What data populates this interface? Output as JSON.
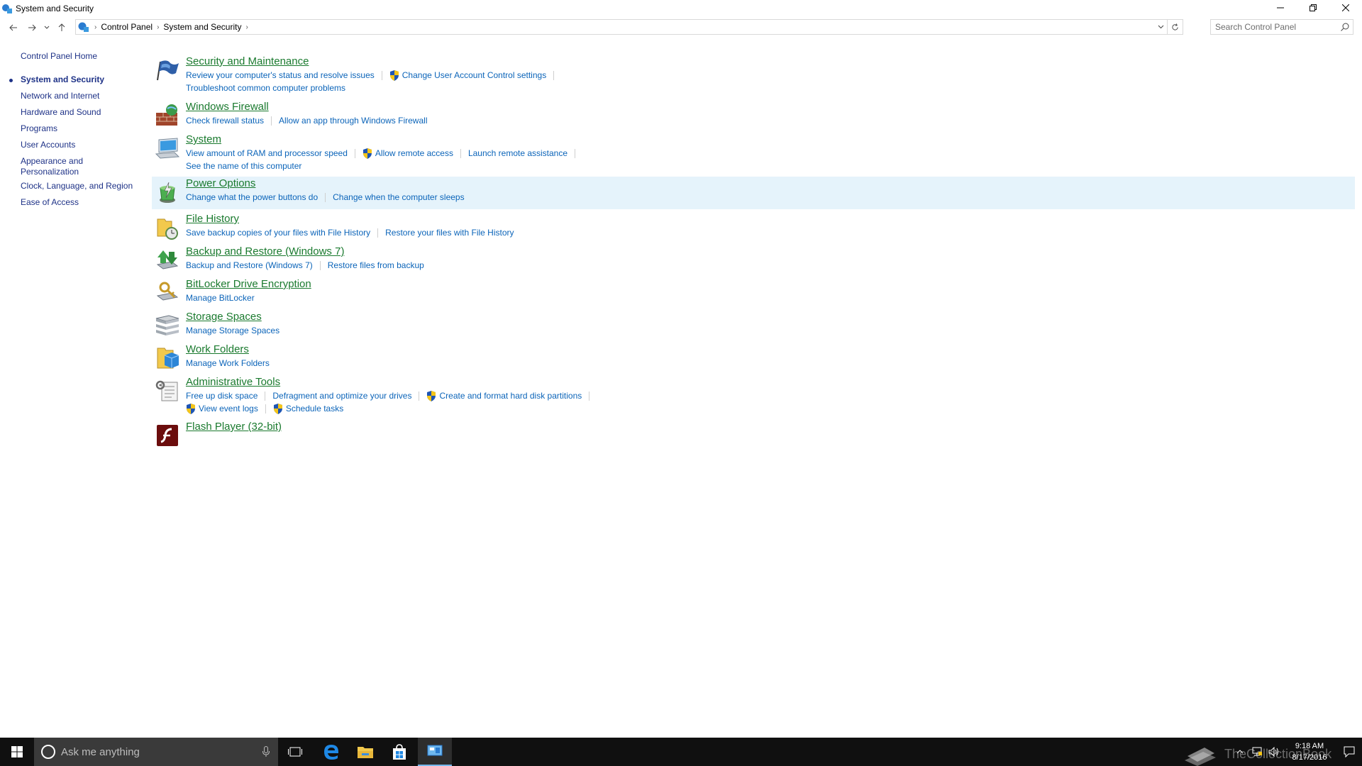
{
  "window": {
    "title": "System and Security"
  },
  "address": {
    "crumbs": [
      "Control Panel",
      "System and Security"
    ],
    "search_placeholder": "Search Control Panel"
  },
  "leftnav": {
    "items": [
      "Control Panel Home",
      "System and Security",
      "Network and Internet",
      "Hardware and Sound",
      "Programs",
      "User Accounts",
      "Appearance and Personalization",
      "Clock, Language, and Region",
      "Ease of Access"
    ],
    "current": "System and Security"
  },
  "categories": [
    {
      "title": "Security and Maintenance",
      "icon": "flag-icon",
      "lines": [
        [
          {
            "text": "Review your computer's status and resolve issues",
            "shield": false
          },
          {
            "text": "Change User Account Control settings",
            "shield": true
          }
        ],
        [
          {
            "text": "Troubleshoot common computer problems",
            "shield": false
          }
        ]
      ]
    },
    {
      "title": "Windows Firewall",
      "icon": "firewall-icon",
      "lines": [
        [
          {
            "text": "Check firewall status",
            "shield": false
          },
          {
            "text": "Allow an app through Windows Firewall",
            "shield": false
          }
        ]
      ]
    },
    {
      "title": "System",
      "icon": "computer-icon",
      "lines": [
        [
          {
            "text": "View amount of RAM and processor speed",
            "shield": false
          },
          {
            "text": "Allow remote access",
            "shield": true
          },
          {
            "text": "Launch remote assistance",
            "shield": false
          }
        ],
        [
          {
            "text": "See the name of this computer",
            "shield": false
          }
        ]
      ]
    },
    {
      "title": "Power Options",
      "icon": "power-options-icon",
      "highlighted": true,
      "lines": [
        [
          {
            "text": "Change what the power buttons do",
            "shield": false
          },
          {
            "text": "Change when the computer sleeps",
            "shield": false
          }
        ]
      ]
    },
    {
      "title": "File History",
      "icon": "file-history-icon",
      "lines": [
        [
          {
            "text": "Save backup copies of your files with File History",
            "shield": false
          },
          {
            "text": "Restore your files with File History",
            "shield": false
          }
        ]
      ]
    },
    {
      "title": "Backup and Restore (Windows 7)",
      "icon": "backup-restore-icon",
      "lines": [
        [
          {
            "text": "Backup and Restore (Windows 7)",
            "shield": false
          },
          {
            "text": "Restore files from backup",
            "shield": false
          }
        ]
      ]
    },
    {
      "title": "BitLocker Drive Encryption",
      "icon": "bitlocker-icon",
      "lines": [
        [
          {
            "text": "Manage BitLocker",
            "shield": false
          }
        ]
      ]
    },
    {
      "title": "Storage Spaces",
      "icon": "storage-spaces-icon",
      "lines": [
        [
          {
            "text": "Manage Storage Spaces",
            "shield": false
          }
        ]
      ]
    },
    {
      "title": "Work Folders",
      "icon": "work-folders-icon",
      "lines": [
        [
          {
            "text": "Manage Work Folders",
            "shield": false
          }
        ]
      ]
    },
    {
      "title": "Administrative Tools",
      "icon": "admin-tools-icon",
      "lines": [
        [
          {
            "text": "Free up disk space",
            "shield": false
          },
          {
            "text": "Defragment and optimize your drives",
            "shield": false
          },
          {
            "text": "Create and format hard disk partitions",
            "shield": true
          }
        ],
        [
          {
            "text": "View event logs",
            "shield": true
          },
          {
            "text": "Schedule tasks",
            "shield": true
          }
        ]
      ]
    },
    {
      "title": "Flash Player (32-bit)",
      "icon": "flash-player-icon",
      "lines": []
    }
  ],
  "taskbar": {
    "search_text": "Ask me anything",
    "time": "9:18 AM",
    "date": "8/17/2016",
    "watermark": "TheCollectionBook"
  },
  "colors": {
    "category_title": "#1a7a2e",
    "link": "#0b64b9",
    "nav_link": "#1e3287",
    "highlight": "#e5f3fb"
  }
}
